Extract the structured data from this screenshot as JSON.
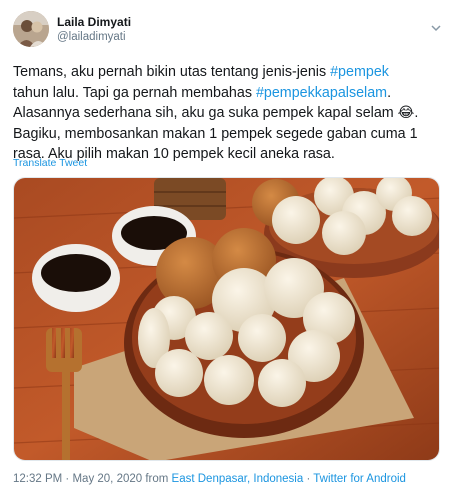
{
  "tweet": {
    "author_name": "Laila Dimyati",
    "author_handle": "@lailadimyati",
    "text": {
      "l1_a": "Temans, aku pernah bikin utas tentang jenis-jenis ",
      "l1_tag": "#pempek",
      "l2_a": "tahun lalu. Tapi ga pernah membahas ",
      "l2_tag": "#pempekkapalselam",
      "l2_b": ".",
      "l3": "Alasannya sederhana sih, aku ga suka pempek kapal selam 😂.",
      "l4": "Bagiku, membosankan makan 1 pempek segede gaban cuma 1",
      "l5": "rasa. Aku pilih makan 10 pempek kecil aneka rasa."
    },
    "translate_label": "Translate Tweet",
    "meta": {
      "time": "12:32 PM",
      "sep1": " · ",
      "date": "May 20, 2020",
      "from": " from ",
      "location": "East Denpasar, Indonesia",
      "sep2": " · ",
      "source": "Twitter for Android"
    }
  },
  "icons": {
    "menu": "chevron-down-icon"
  },
  "colors": {
    "link": "#1b95e0",
    "secondary": "#657786",
    "text": "#14171a"
  }
}
